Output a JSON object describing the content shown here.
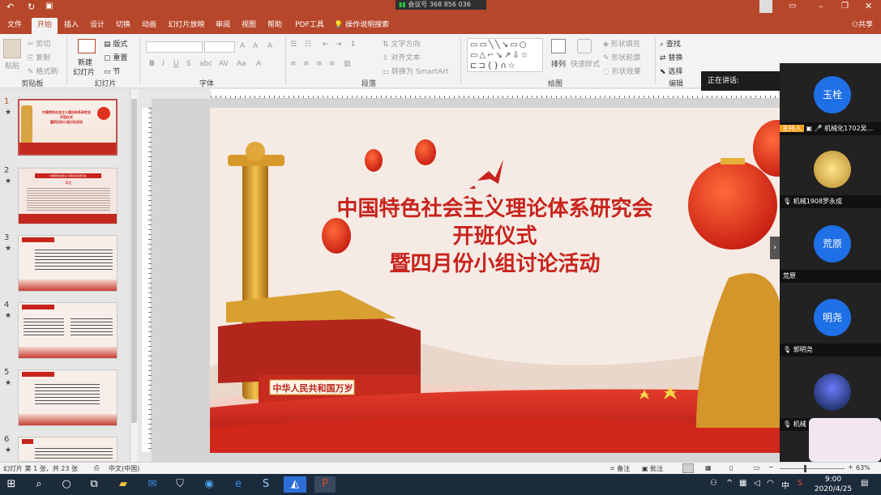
{
  "titlebar": {
    "meeting_id": "会议号 368 856 036",
    "icons": [
      "undo-icon",
      "redo-icon",
      "slideshow-icon",
      "account-icon",
      "ribbon-display-icon",
      "minimize-icon",
      "restore-icon",
      "close-icon"
    ]
  },
  "tabs": [
    "文件",
    "开始",
    "插入",
    "设计",
    "切换",
    "动画",
    "幻灯片放映",
    "审阅",
    "视图",
    "帮助",
    "PDF工具"
  ],
  "tell_me": "操作说明搜索",
  "share": "共享",
  "ribbon": {
    "clipboard": {
      "paste": "粘贴",
      "cut": "剪切",
      "copy": "复制",
      "format_painter": "格式刷",
      "group": "剪贴板"
    },
    "slides": {
      "new_slide": "新建",
      "new_slide2": "幻灯片",
      "layout": "版式",
      "reset": "重置",
      "section": "节",
      "group": "幻灯片"
    },
    "font": {
      "group": "字体"
    },
    "paragraph": {
      "text_direction": "文字方向",
      "align_text": "对齐文本",
      "smartart": "转换为 SmartArt",
      "group": "段落"
    },
    "drawing": {
      "arrange": "排列",
      "quick_styles": "快速样式",
      "shape_fill": "形状填充",
      "shape_outline": "形状轮廓",
      "shape_effects": "形状效果",
      "group": "绘图"
    },
    "editing": {
      "find": "查找",
      "replace": "替换",
      "select": "选择",
      "group": "编辑"
    }
  },
  "slide": {
    "title_line1": "中国特色社会主义理论体系研究会",
    "title_line2": "开班仪式",
    "title_line3": "暨四月份小组讨论活动",
    "banner": "中华人民共和国万岁"
  },
  "thumbnails": [
    {
      "num": "1",
      "star": "★"
    },
    {
      "num": "2",
      "star": "★"
    },
    {
      "num": "3",
      "star": "★"
    },
    {
      "num": "4",
      "star": "★"
    },
    {
      "num": "5",
      "star": "★"
    },
    {
      "num": "6",
      "star": "★"
    }
  ],
  "thumb_text": {
    "t1_line1": "中国特色社会主义理论体系研究会",
    "t1_line2": "开班仪式",
    "t1_line3": "暨四月份小组讨论活动",
    "t2_head": "中国特色社会主义理论体系研究会",
    "t2_sub": "简史"
  },
  "meeting": {
    "speaking": "正在讲话:",
    "participants": [
      {
        "avatar": "玉栓",
        "role": "主持人",
        "label": "机械化1702吴..."
      },
      {
        "avatar": "",
        "label": "机械1908罗永成"
      },
      {
        "avatar": "荒原",
        "label": "荒原"
      },
      {
        "avatar": "明尧",
        "label": "郭明尧"
      },
      {
        "avatar": "",
        "label": "机械"
      }
    ]
  },
  "status": {
    "slide_info": "幻灯片 第 1 张，共 23 张",
    "language": "中文(中国)",
    "notes": "备注",
    "comments": "批注",
    "zoom": "63%"
  },
  "taskbar": {
    "time": "9:00",
    "date": "2020/4/25",
    "ime": "中"
  },
  "colors": {
    "accent": "#b7472a",
    "title_red": "#c8231d",
    "taskbar": "#1c2b3c",
    "avatar_blue": "#1f6fe6"
  }
}
